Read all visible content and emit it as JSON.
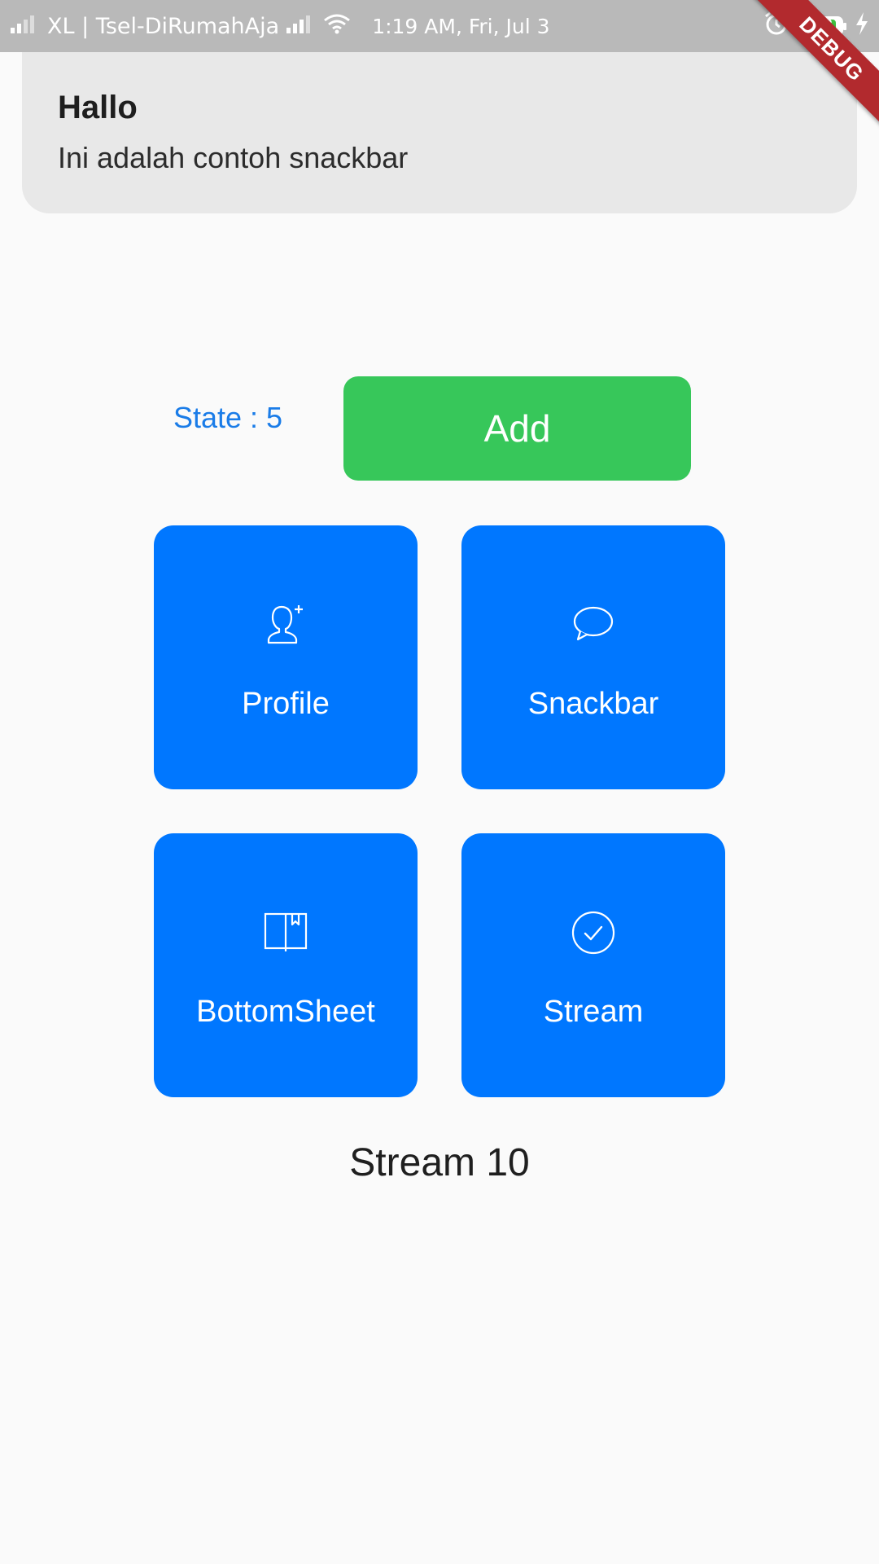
{
  "status_bar": {
    "carrier": "XL | Tsel-DiRumahAja",
    "time": "1:19 AM, Fri, Jul 3",
    "battery": "98",
    "icons": [
      "signal-icon",
      "signal-icon",
      "wifi-icon",
      "alarm-icon",
      "battery-icon",
      "charging-icon"
    ]
  },
  "debug_banner": "DEBUG",
  "snackbar": {
    "title": "Hallo",
    "message": "Ini adalah contoh snackbar"
  },
  "counter": {
    "state_label": "State : 5",
    "add_label": "Add"
  },
  "tiles": [
    {
      "label": "Profile",
      "icon": "person-add-icon"
    },
    {
      "label": "Snackbar",
      "icon": "chat-bubble-icon"
    },
    {
      "label": "BottomSheet",
      "icon": "book-icon"
    },
    {
      "label": "Stream",
      "icon": "check-circle-icon"
    }
  ],
  "stream_text": "Stream 10",
  "colors": {
    "status_bar": "#b9b9b9",
    "tile": "#0077ff",
    "add_button": "#37c75a",
    "state_text": "#1a7ce8",
    "snackbar_bg": "#e8e8e8",
    "debug_ribbon": "#b22a2e"
  }
}
